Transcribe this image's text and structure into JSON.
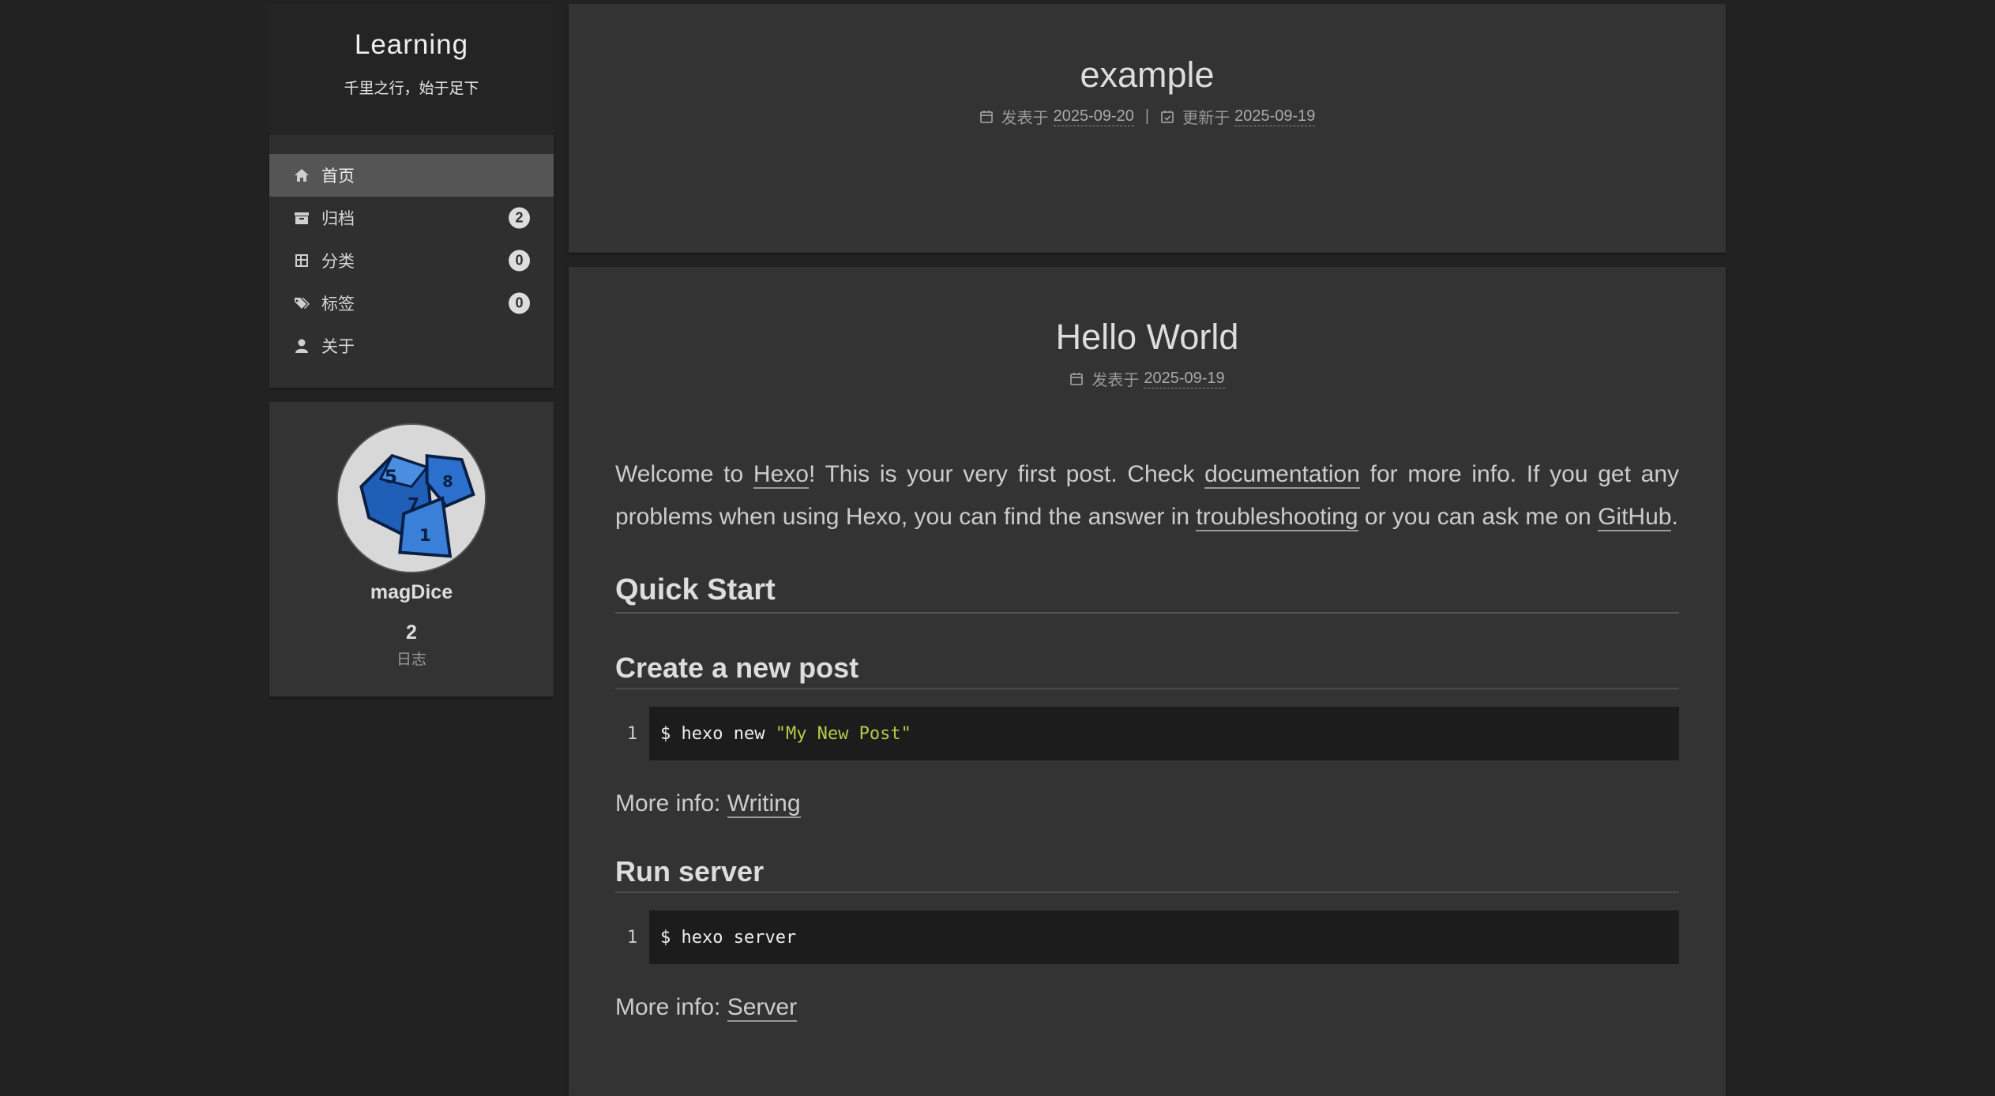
{
  "site": {
    "title": "Learning",
    "subtitle": "千里之行，始于足下"
  },
  "menu": [
    {
      "label": "首页",
      "icon": "home-icon",
      "active": true
    },
    {
      "label": "归档",
      "icon": "archive-icon",
      "badge": "2"
    },
    {
      "label": "分类",
      "icon": "grid-icon",
      "badge": "0"
    },
    {
      "label": "标签",
      "icon": "tags-icon",
      "badge": "0"
    },
    {
      "label": "关于",
      "icon": "user-icon"
    }
  ],
  "author": {
    "name": "magDice",
    "avatar": "dice-avatar",
    "stat_count": "2",
    "stat_label": "日志"
  },
  "posts": [
    {
      "title": "example",
      "published_label": "发表于",
      "published_date": "2025-09-20",
      "separator": "|",
      "updated_label": "更新于",
      "updated_date": "2025-09-19"
    },
    {
      "title": "Hello World",
      "published_label": "发表于",
      "published_date": "2025-09-19",
      "intro": {
        "t1": "Welcome to ",
        "link1": "Hexo",
        "t2": "! This is your very first post. Check ",
        "link2": "documentation",
        "t3": " for more info. If you get any problems when using Hexo, you can find the answer in ",
        "link3": "troubleshooting",
        "t4": " or you can ask me on ",
        "link4": "GitHub",
        "t5": "."
      },
      "h_quick_start": "Quick Start",
      "sections": [
        {
          "heading": "Create a new post",
          "line_no": "1",
          "code_cmd": "$ hexo new ",
          "code_str": "\"My New Post\"",
          "more_label": "More info: ",
          "more_link": "Writing"
        },
        {
          "heading": "Run server",
          "line_no": "1",
          "code_cmd": "$ hexo server",
          "code_str": "",
          "more_label": "More info: ",
          "more_link": "Server"
        }
      ]
    }
  ]
}
